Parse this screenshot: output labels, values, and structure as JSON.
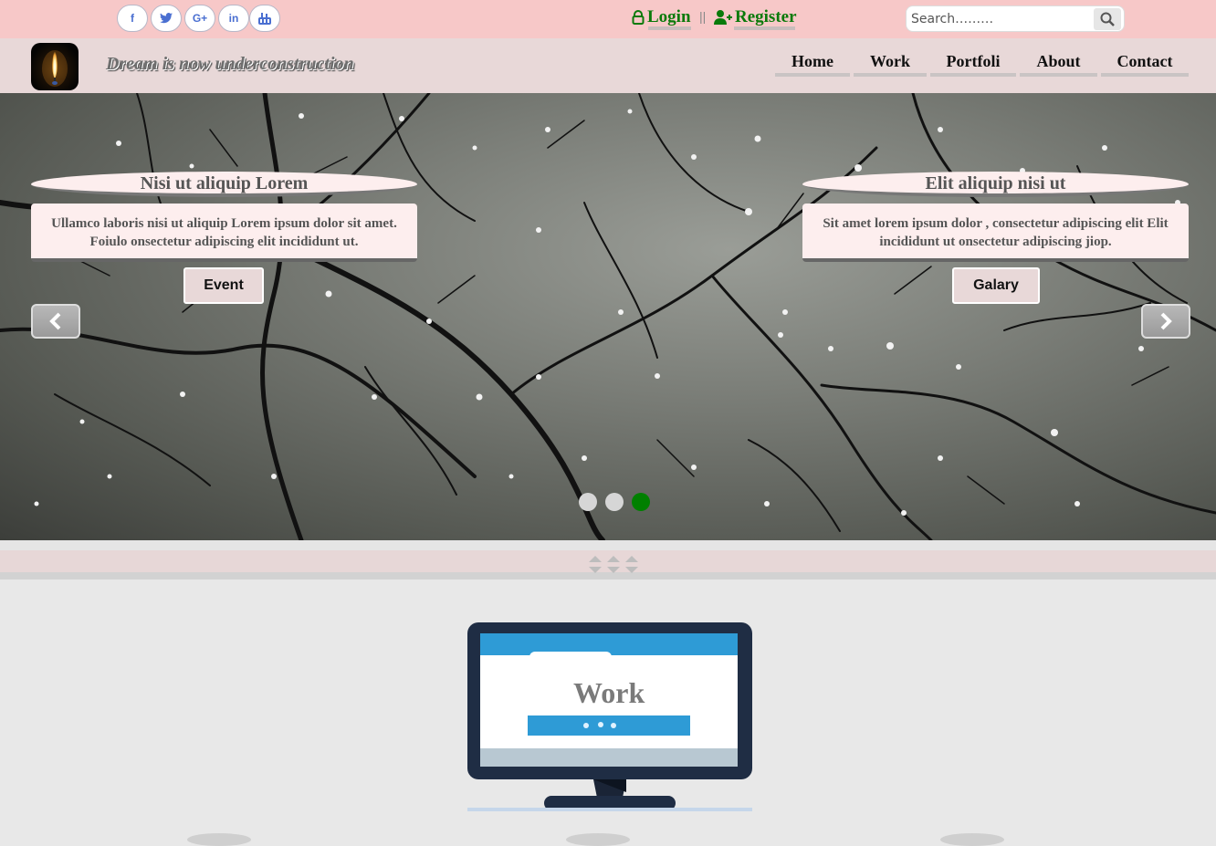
{
  "social": [
    {
      "icon": "facebook-icon",
      "glyph": "f"
    },
    {
      "icon": "twitter-icon",
      "glyph": "t"
    },
    {
      "icon": "google-plus-icon",
      "glyph": "G+"
    },
    {
      "icon": "linkedin-icon",
      "glyph": "in"
    },
    {
      "icon": "youtube-icon",
      "glyph": "▶"
    }
  ],
  "auth": {
    "login": "Login",
    "separator": "||",
    "register": "Register"
  },
  "search": {
    "placeholder": "Search………"
  },
  "header": {
    "tagline": "Dream is now underconstruction"
  },
  "nav": [
    {
      "label": "Home"
    },
    {
      "label": "Work"
    },
    {
      "label": "Portfoli"
    },
    {
      "label": "About"
    },
    {
      "label": "Contact"
    }
  ],
  "slider": {
    "left": {
      "title": "Nisi ut aliquip Lorem",
      "text": "Ullamco laboris nisi ut aliquip Lorem ipsum dolor sit amet. Foiulo onsectetur adipiscing elit incididunt ut.",
      "button": "Event"
    },
    "right": {
      "title": "Elit aliquip nisi ut",
      "text": "Sit amet lorem ipsum dolor , consectetur adipiscing elit Elit incididunt ut onsectetur adipiscing jiop.",
      "button": "Galary"
    },
    "active_dot": 3,
    "dot_count": 3
  },
  "work": {
    "label": "Work"
  },
  "colors": {
    "topbar": "#f7c8c8",
    "header": "#e8d8d8",
    "auth_green": "#0a7a0a",
    "active_dot": "#008000",
    "monitor_frame": "#1f2d44",
    "monitor_accent": "#2e9bd6"
  }
}
